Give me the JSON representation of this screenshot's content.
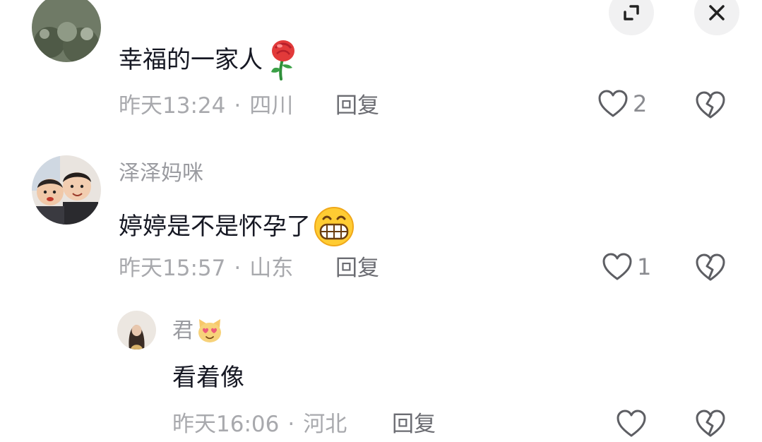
{
  "comments": [
    {
      "text": "幸福的一家人",
      "emoji": "rose-emoji",
      "time": "昨天13:24",
      "location": "四川",
      "reply_label": "回复",
      "likes": "2"
    },
    {
      "username": "泽泽妈咪",
      "text": "婷婷是不是怀孕了",
      "emoji": "grinning-emoji",
      "time": "昨天15:57",
      "location": "山东",
      "reply_label": "回复",
      "likes": "1"
    }
  ],
  "reply": {
    "username": "君",
    "username_emoji": "heart-eyes-cat-emoji",
    "text": "看着像",
    "time": "昨天16:06",
    "location": "河北",
    "reply_label": "回复"
  },
  "separator": "·",
  "top_buttons": [
    "expand-icon",
    "close-icon"
  ],
  "colors": {
    "text": "#161823",
    "meta": "#a8a9ad",
    "icon": "#5d5e63",
    "button_bg": "#f1f1f2"
  }
}
